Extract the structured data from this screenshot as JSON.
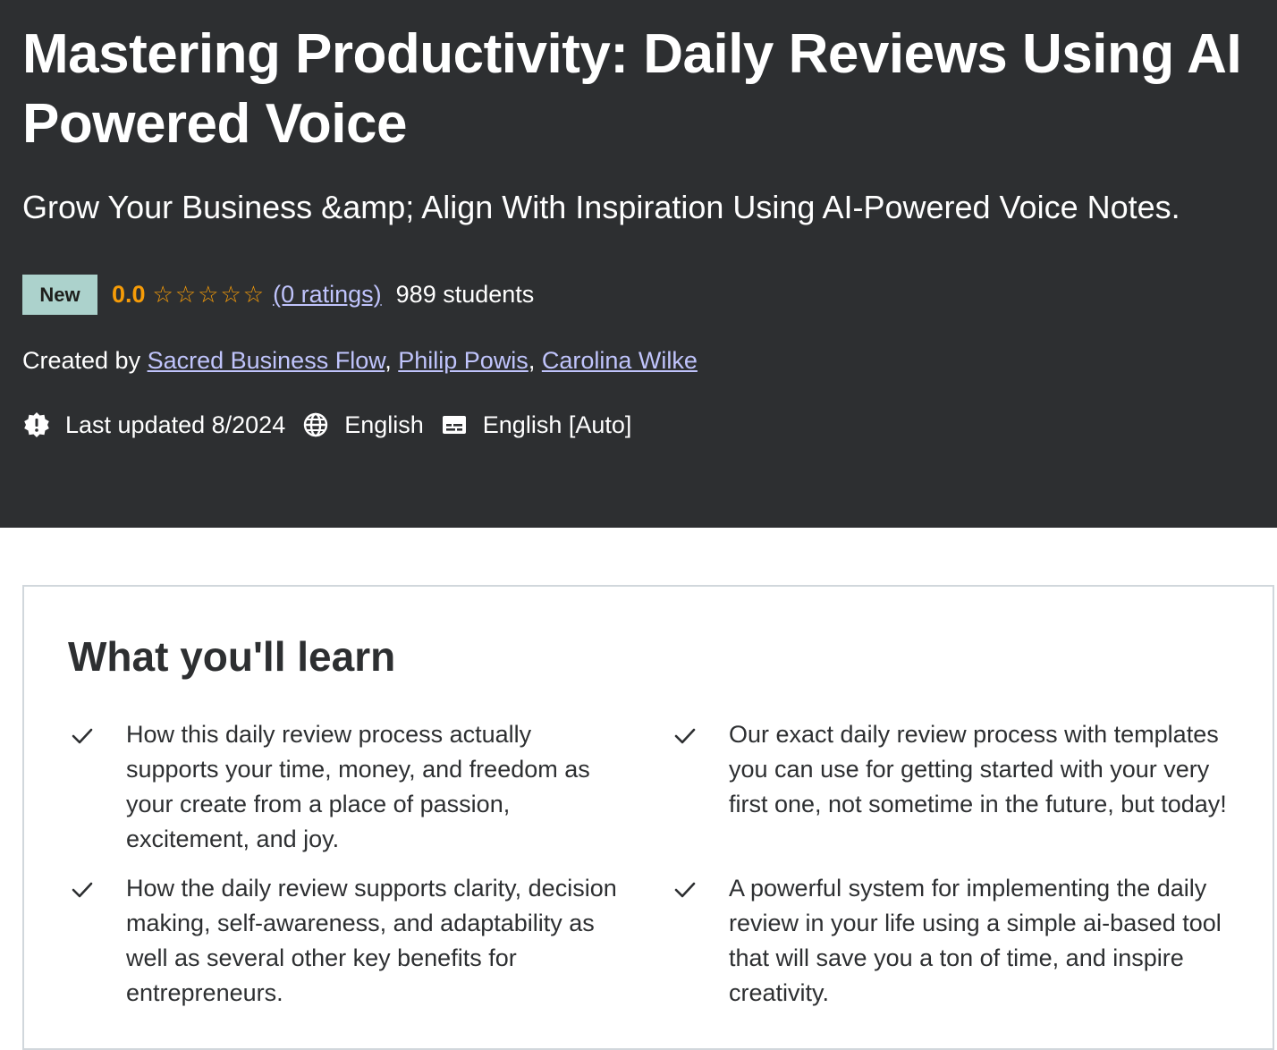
{
  "course": {
    "title": "Mastering Productivity: Daily Reviews Using AI Powered Voice",
    "subtitle": "Grow Your Business &amp; Align With Inspiration Using AI-Powered Voice Notes.",
    "badge": "New",
    "rating": "0.0",
    "stars_filled": 0,
    "stars_total": 5,
    "ratings_link": "(0 ratings)",
    "students": "989 students"
  },
  "created_by": {
    "label": "Created by",
    "instructors": [
      "Sacred Business Flow",
      "Philip Powis",
      "Carolina Wilke"
    ],
    "separator": ","
  },
  "meta": {
    "last_updated": "Last updated 8/2024",
    "language": "English",
    "captions": "English [Auto]"
  },
  "icons": {
    "updated": "alert-badge-icon",
    "language": "globe-icon",
    "captions": "closed-captions-icon",
    "check": "check-icon",
    "star": "star-outline-icon"
  },
  "learn": {
    "title": "What you'll learn",
    "items": [
      "How this daily review process actually supports your time, money, and freedom as your create from a place of passion, excitement, and joy.",
      "Our exact daily review process with templates you can use for getting started with your very first one, not sometime in the future, but today!",
      "How the daily review supports clarity, decision making, self-awareness, and adaptability as well as several other key benefits for entrepreneurs.",
      "A powerful system for implementing the daily review in your life using a simple ai-based tool that will save you a ton of time, and inspire creativity."
    ]
  },
  "colors": {
    "hero_bg": "#2d2f31",
    "badge_bg": "#acd2cc",
    "rating_orange": "#f69c08",
    "link_purple": "#c0c4fc",
    "text_dark": "#2d2f31",
    "border": "#d1d7dc"
  }
}
